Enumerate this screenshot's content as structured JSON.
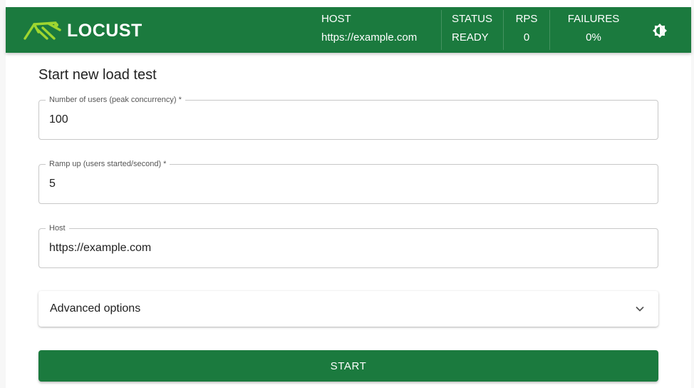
{
  "app": {
    "name": "LOCUST"
  },
  "header": {
    "host_label": "HOST",
    "host_value": "https://example.com",
    "status_label": "STATUS",
    "status_value": "READY",
    "rps_label": "RPS",
    "rps_value": "0",
    "failures_label": "FAILURES",
    "failures_value": "0%"
  },
  "form": {
    "title": "Start new load test",
    "users": {
      "label": "Number of users (peak concurrency) *",
      "value": "100"
    },
    "ramp_up": {
      "label": "Ramp up (users started/second) *",
      "value": "5"
    },
    "host": {
      "label": "Host",
      "value": "https://example.com"
    },
    "advanced_label": "Advanced options",
    "start_label": "START"
  },
  "icons": {
    "logo": "locust-logo-icon",
    "theme": "theme-toggle-icon",
    "expand": "chevron-down-icon"
  },
  "colors": {
    "brand_green": "#1b7a3e",
    "logo_green": "#9fd630"
  }
}
